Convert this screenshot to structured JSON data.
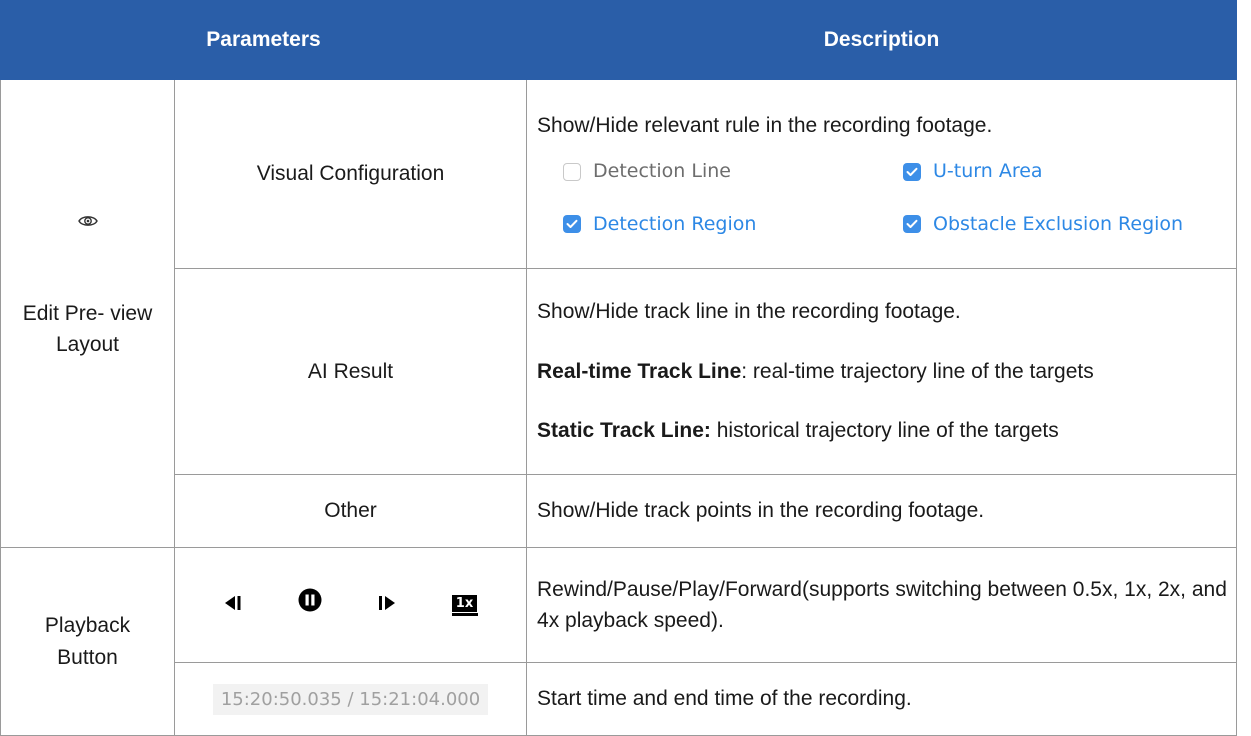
{
  "header": {
    "parameters": "Parameters",
    "description": "Description"
  },
  "edit": {
    "label": "Edit Pre- view Layout",
    "icon": "eye-icon",
    "visual": {
      "name": "Visual Configuration",
      "description": "Show/Hide relevant rule in the recording footage.",
      "checkboxes": [
        {
          "label": "Detection Line",
          "checked": false
        },
        {
          "label": "U-turn Area",
          "checked": true
        },
        {
          "label": "Detection Region",
          "checked": true
        },
        {
          "label": "Obstacle Exclusion Region",
          "checked": true
        }
      ]
    },
    "ai": {
      "name": "AI Result",
      "line1": "Show/Hide track line in the recording footage.",
      "realtime_bold": "Real-time Track Line",
      "realtime_rest": ": real-time trajectory line of the targets",
      "static_bold": "Static Track Line:",
      "static_rest": " historical trajectory line of the targets"
    },
    "other": {
      "name": "Other",
      "description": "Show/Hide track points in the recording footage."
    }
  },
  "playback": {
    "label": "Playback Button",
    "icons": [
      "rewind-icon",
      "pause-icon",
      "play-icon",
      "speed-1x-icon"
    ],
    "speed_text": "1x",
    "buttons_description": "Rewind/Pause/Play/Forward(supports switching between 0.5x, 1x, 2x, and 4x playback speed).",
    "time_display": "15:20:50.035 / 15:21:04.000",
    "time_description": "Start time and end time of the recording."
  },
  "colors": {
    "header_bg": "#2a5ea8",
    "checkbox_blue": "#3d8fe8"
  }
}
